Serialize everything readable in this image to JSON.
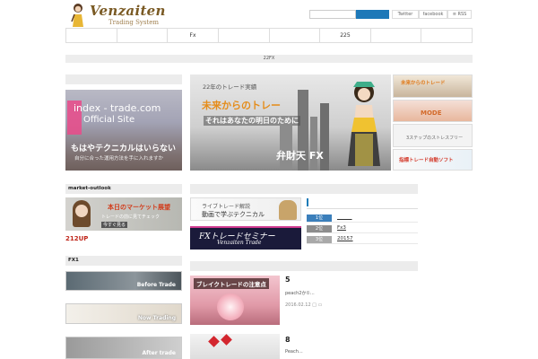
{
  "header": {
    "logo_title": "Venzaiten",
    "logo_subtitle": "Trading System",
    "search_placeholder": "",
    "social": [
      "Twitter",
      "facebook",
      "RSS"
    ]
  },
  "nav": {
    "items": [
      "",
      "",
      "Fx",
      "",
      "",
      "225",
      "",
      ""
    ]
  },
  "subbar": {
    "text": "22FX"
  },
  "left": {
    "banner_index": {
      "line1": "index - trade.com",
      "line2": "Official Site",
      "line3": "もはやテクニカルはいらない",
      "line4": "自分に合った運用方法を手に入れますか"
    },
    "market_head": "market-outlook",
    "market_banner": {
      "title": "本日のマーケット展望",
      "sub": "トレードの前に見てチェック",
      "tag": "今すぐ見る"
    },
    "label_212": "212UP",
    "fx_head": "FX1",
    "fx_banners": [
      "Before Trade",
      "Now Trading",
      "After trade"
    ]
  },
  "hero": {
    "line1": "22年のトレード実績",
    "line2": "未来からのトレー",
    "line3": "それはあなたの明日のために",
    "line4": "弁財天 FX"
  },
  "right_thumbs": [
    "未来からのトレード",
    "MODE",
    "3ステップのストレスフリー",
    "指標トレード自動ソフト"
  ],
  "live": {
    "title1": "ライブトレード解説",
    "title2": "動画で学ぶテクニカル"
  },
  "seminar": {
    "title": "FXトレードセミナー",
    "sub": "Venzaiten Trade"
  },
  "ranking": [
    {
      "badge": "1位",
      "text": "______"
    },
    {
      "badge": "2位",
      "text": "Fx3"
    },
    {
      "badge": "3位",
      "text": "20157"
    }
  ],
  "articles": [
    {
      "num": "5",
      "image_caption": "ブレイクトレードの注意点",
      "excerpt": "peach2か①...",
      "date": "2016.02.12",
      "meta_icons": [
        "folder-icon",
        "comment-icon"
      ]
    },
    {
      "num": "8",
      "excerpt": "Peach..."
    }
  ],
  "colors": {
    "accent_blue": "#1d78b8",
    "brand_brown": "#7a5a24",
    "red_label": "#c0271b"
  }
}
